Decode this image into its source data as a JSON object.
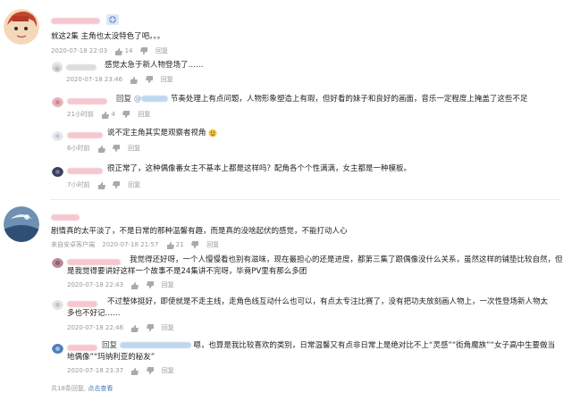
{
  "top_comment_1": {
    "text": "就这2集 主角也太没特色了吧。。。",
    "date": "2020-07-18 22:03",
    "likes": "14",
    "reply": "回复"
  },
  "replies_1": [
    {
      "text": "感觉太急于新人物登场了……",
      "time": "2020-07-18 23:46",
      "likes": "",
      "reply": "回复",
      "prefix": ""
    },
    {
      "prefix": "回复",
      "mention": "@",
      "text": "节奏处理上有点问题，人物形象塑造上有瑕，但好看的妹子和良好的画面，音乐一定程度上掩盖了这些不足",
      "time": "21小时前",
      "likes": "4",
      "reply": "回复"
    },
    {
      "text": "说不定主角其实是观察者视角",
      "time": "6小时前",
      "likes": "",
      "reply": "回复",
      "prefix": ""
    },
    {
      "text": "很正常了，这种偶像番女主不基本上都是这样吗？配角各个个性满满，女主都是一种模板。",
      "time": "7小时前",
      "likes": "",
      "reply": "回复",
      "prefix": ""
    }
  ],
  "top_comment_2": {
    "text": "剧情真的太平淡了，不是日常的那种温馨有趣，而是真的没啥起伏的感觉，不能打动人心",
    "device": "来自安卓客户端",
    "date": "2020-07-18 21:57",
    "likes": "21",
    "reply": "回复"
  },
  "replies_2": [
    {
      "text": "我觉得还好呀，一个人慢慢看也别有滋味，现在最担心的还是进度，都第三集了跟偶像没什么关系，虽然这样的铺垫比较自然，但是我觉得要讲好这样一个故事不是24集讲不完呀，毕竟PV里有那么多团",
      "time": "2020-07-18 22:43",
      "likes": "",
      "reply": "回复"
    },
    {
      "text": "不过整体挺好，即使就是不走主线，走角色线互动什么也可以，有点太专注比赛了，没有把功夫放刻画人物上，一次性登场新人物太多也不好记……",
      "time": "2020-07-18 22:46",
      "likes": "",
      "reply": "回复"
    },
    {
      "prefix": "回复",
      "text": "嗯，也算是我比较喜欢的类别，日常温馨又有点非日常上是绝对比不上“灵感”“街角魔族”“女子高中生要做当地偶像”“玛纳利亚的秘友”",
      "time": "2020-07-18 23:37",
      "likes": "",
      "reply": "回复"
    }
  ],
  "footer": {
    "total": "共18条回复,",
    "link": "点击查看"
  },
  "colors": {
    "text": "#222222",
    "meta": "#999999",
    "link": "#4a79b5"
  }
}
